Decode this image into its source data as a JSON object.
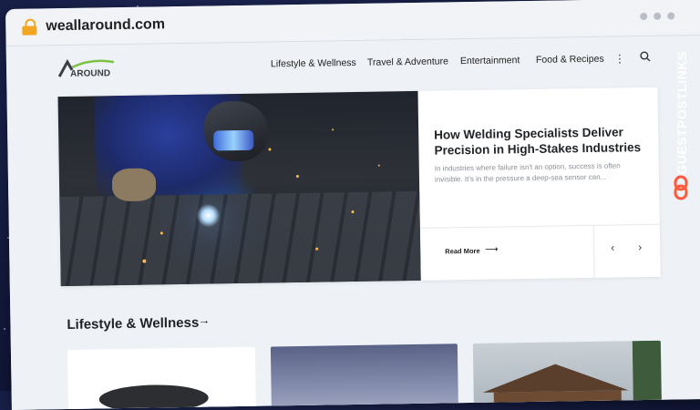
{
  "browser": {
    "url": "weallaround.com"
  },
  "site": {
    "logo_text": "AROUND",
    "nav": [
      {
        "label": "Lifestyle & Wellness"
      },
      {
        "label": "Travel & Adventure"
      },
      {
        "label": "Entertainment"
      },
      {
        "label": "Food & Recipes"
      }
    ],
    "more_icon": "kebab-icon",
    "search_icon": "search-icon"
  },
  "hero": {
    "title": "How Welding Specialists Deliver Precision in High-Stakes Industries",
    "excerpt": "In industries where failure isn't an option, success is often invisible. It's in the pressure a deep-sea sensor can...",
    "read_more": "Read More",
    "prev": "‹",
    "next": "›"
  },
  "section": {
    "title": "Lifestyle & Wellness"
  },
  "watermark": {
    "text": "GUESTPOSTLINKS"
  },
  "colors": {
    "lock": "#f3a61f",
    "logo_accent": "#7cc242",
    "watermark_logo": "#ff5a3c"
  }
}
